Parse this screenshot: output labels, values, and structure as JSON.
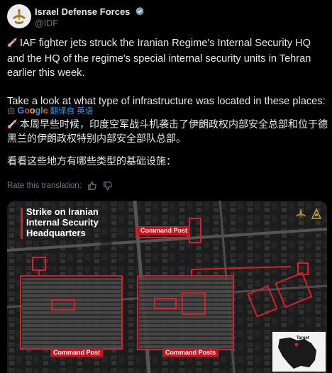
{
  "account": {
    "name": "Israel Defense Forces",
    "handle": "@IDF"
  },
  "tweet": {
    "paragraph1": "IAF fighter jets struck the Iranian Regime's Internal Security HQ and the HQ of the regime's special internal security units in Tehran earlier this week.",
    "paragraph2": "Take a look at what type of infrastructure was located in these places:",
    "translated_by": "由",
    "google": "Google",
    "translated_from": "翻译自 英语",
    "zh_paragraph1": "本周早些时候，印度空军战斗机袭击了伊朗政权内部安全总部和位于德黑兰的伊朗政权特别内部安全部队总部。",
    "zh_paragraph2": "看看这些地方有哪些类型的基础设施：",
    "rate_label": "Rate this translation:"
  },
  "media": {
    "title_line1": "Strike on Iranian",
    "title_line2": "Internal Security",
    "title_line3": "Headquarters",
    "label_top": "Command Post",
    "label_bottom_left": "Command Post",
    "label_bottom_right": "Command Posts",
    "map_label": "Target"
  },
  "colors": {
    "background": "#000000",
    "text": "#e7e9ea",
    "muted": "#71767b",
    "link": "#1d9bf0",
    "verified": "#829aab",
    "strike_red": "#d81e2a"
  }
}
